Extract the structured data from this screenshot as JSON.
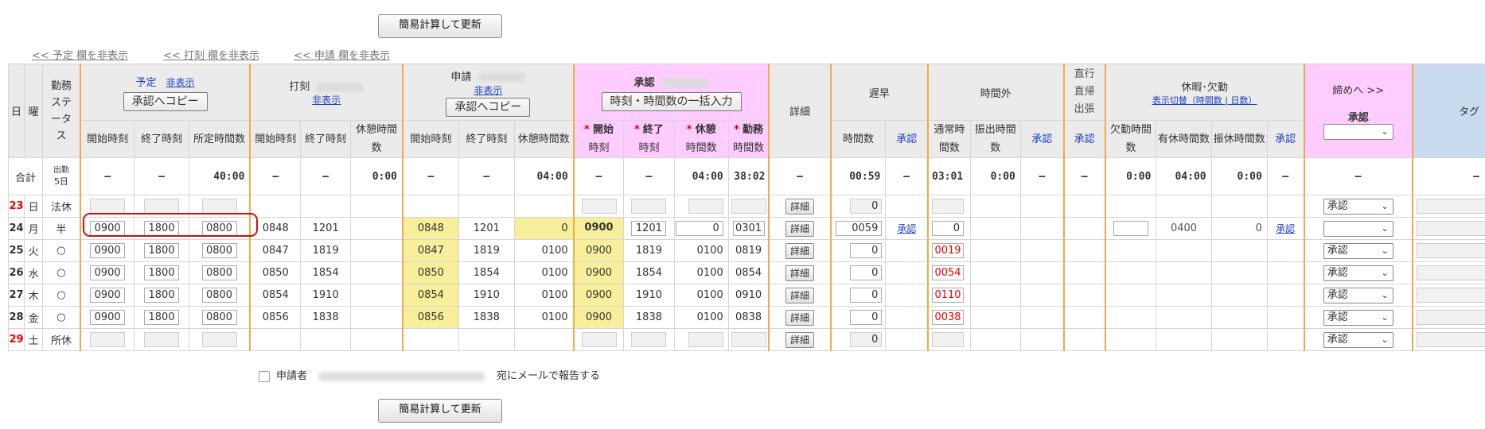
{
  "buttons": {
    "update_top": "簡易計算して更新",
    "update_bottom": "簡易計算して更新"
  },
  "hide_links": [
    "<< 予定 欄を非表示",
    "<< 打刻 欄を非表示",
    "<< 申請 欄を非表示"
  ],
  "header": {
    "day": "日",
    "dow": "曜",
    "status": "勤務ステータス",
    "plan": {
      "label": "予定",
      "hide": "非表示",
      "copy": "承認へコピー"
    },
    "punch": {
      "label": "打刻",
      "hide": "非表示"
    },
    "apply": {
      "label": "申請",
      "hide": "非表示",
      "copy": "承認へコピー"
    },
    "approve": {
      "label": "承認",
      "bulk": "時刻・時間数の一括入力"
    },
    "detail": "詳細",
    "late_early": "遅早",
    "overtime": "時間外",
    "direct": "直行直帰出張",
    "leave": {
      "label": "休暇･欠勤",
      "toggle": "表示切替（時間数 | 日数）"
    },
    "close": {
      "label": "締めへ >>",
      "approve": "承認"
    },
    "tag": "タグ"
  },
  "subheaders": {
    "start": "開始時刻",
    "end": "終了時刻",
    "scheduled": "所定時間数",
    "break": "休憩時間数",
    "star": "*",
    "start_s": "開始",
    "end_s": "終了",
    "break_s": "休憩",
    "work_s": "勤務",
    "time_s": "時刻",
    "hours_s": "時間数",
    "hours": "時間数",
    "approve": "承認",
    "normal": "通常時間数",
    "transfer": "振出時間数",
    "absence": "欠勤時間数",
    "paid": "有休時間数",
    "comp": "振休時間数"
  },
  "totals": {
    "label": "合計",
    "workdays_label": "出勤",
    "workdays": "5日",
    "dash": "–",
    "plan_hours": "40:00",
    "punch_break": "0:00",
    "apply_break": "04:00",
    "appr_break": "04:00",
    "appr_work": "38:02",
    "late_hours": "00:59",
    "ot_normal": "03:01",
    "ot_transfer": "0:00",
    "absence": "0:00",
    "paid": "04:00",
    "comp": "0:00"
  },
  "rows": [
    {
      "day": "23",
      "dow": "日",
      "status": "法休",
      "red": true,
      "late": "0",
      "closeSel": "承認"
    },
    {
      "day": "24",
      "dow": "月",
      "status": "半",
      "p_start": "0900",
      "p_end": "1800",
      "p_hours": "0800",
      "k_start": "0848",
      "k_end": "1201",
      "a_start": "0848",
      "a_end": "1201",
      "a_break": "0",
      "ap_start": "0900",
      "ap_end": "1201",
      "ap_break": "0",
      "ap_work": "0301",
      "late": "0059",
      "late_approve": "承認",
      "ot": "0",
      "paid": "0400",
      "comp": "0",
      "leave_approve": "承認",
      "closeSel": ""
    },
    {
      "day": "25",
      "dow": "火",
      "status": "○",
      "p_start": "0900",
      "p_end": "1800",
      "p_hours": "0800",
      "k_start": "0847",
      "k_end": "1819",
      "a_start": "0847",
      "a_end": "1819",
      "a_break": "0100",
      "ap_start": "0900",
      "ap_end": "1819",
      "ap_break": "0100",
      "ap_work": "0819",
      "late": "0",
      "ot": "0019",
      "closeSel": "承認"
    },
    {
      "day": "26",
      "dow": "水",
      "status": "○",
      "p_start": "0900",
      "p_end": "1800",
      "p_hours": "0800",
      "k_start": "0850",
      "k_end": "1854",
      "a_start": "0850",
      "a_end": "1854",
      "a_break": "0100",
      "ap_start": "0900",
      "ap_end": "1854",
      "ap_break": "0100",
      "ap_work": "0854",
      "late": "0",
      "ot": "0054",
      "closeSel": "承認"
    },
    {
      "day": "27",
      "dow": "木",
      "status": "○",
      "p_start": "0900",
      "p_end": "1800",
      "p_hours": "0800",
      "k_start": "0854",
      "k_end": "1910",
      "a_start": "0854",
      "a_end": "1910",
      "a_break": "0100",
      "ap_start": "0900",
      "ap_end": "1910",
      "ap_break": "0100",
      "ap_work": "0910",
      "late": "0",
      "ot": "0110",
      "closeSel": "承認"
    },
    {
      "day": "28",
      "dow": "金",
      "status": "○",
      "p_start": "0900",
      "p_end": "1800",
      "p_hours": "0800",
      "k_start": "0856",
      "k_end": "1838",
      "a_start": "0856",
      "a_end": "1838",
      "a_break": "0100",
      "ap_start": "0900",
      "ap_end": "1838",
      "ap_break": "0100",
      "ap_work": "0838",
      "late": "0",
      "ot": "0038",
      "closeSel": "承認"
    },
    {
      "day": "29",
      "dow": "土",
      "status": "所休",
      "red": true,
      "late": "0",
      "closeSel": "承認"
    }
  ],
  "detail_btn": "詳細",
  "mail": {
    "label": "申請者",
    "suffix": "宛にメールで報告する"
  }
}
